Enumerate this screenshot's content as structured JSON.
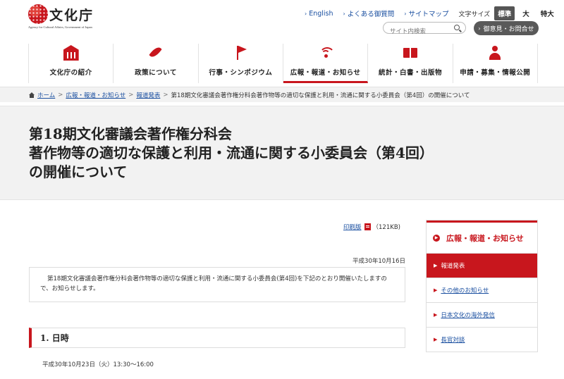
{
  "logo": {
    "text": "文化庁",
    "subtitle": "Agency for Cultural Affairs, Government of Japan"
  },
  "toplinks": [
    {
      "label": "English"
    },
    {
      "label": "よくある御質問"
    },
    {
      "label": "サイトマップ"
    }
  ],
  "font_size": {
    "label": "文字サイズ",
    "options": [
      "標準",
      "大",
      "特大"
    ],
    "selected": "標準"
  },
  "search": {
    "placeholder": "サイト内検索"
  },
  "opinion_button": {
    "label": "御意見・お問合せ"
  },
  "global_nav": [
    {
      "label": "文化庁の紹介",
      "icon": "building-icon"
    },
    {
      "label": "政策について",
      "icon": "feather-icon"
    },
    {
      "label": "行事・シンポジウム",
      "icon": "flag-icon"
    },
    {
      "label": "広報・報道・お知らせ",
      "icon": "broadcast-icon",
      "active": true
    },
    {
      "label": "統計・白書・出版物",
      "icon": "book-icon"
    },
    {
      "label": "申請・募集・情報公開",
      "icon": "person-icon"
    }
  ],
  "breadcrumb": {
    "items": [
      "ホーム",
      "広報・報道・お知らせ",
      "報道発表"
    ],
    "separator": ">",
    "current": "第18期文化審議会著作権分科会著作物等の適切な保護と利用・流通に関する小委員会（第4回）の開催について"
  },
  "page_title": {
    "line1": "第18期文化審議会著作権分科会",
    "line2": "著作物等の適切な保護と利用・流通に関する小委員会（第4回）",
    "line3": "の開催について"
  },
  "print": {
    "label": "印刷版",
    "size": "（121KB)"
  },
  "date": "平成30年10月16日",
  "lead": "第18期文化審議会著作権分科会著作物等の適切な保護と利用・流通に関する小委員会(第4回)を下記のとおり開催いたしますので、お知らせします。",
  "section1": {
    "heading": "1.  日時",
    "body": "平成30年10月23日（火）13:30～16:00"
  },
  "sidenav": {
    "heading": "広報・報道・お知らせ",
    "items": [
      {
        "label": "報道発表",
        "active": true
      },
      {
        "label": "その他のお知らせ"
      },
      {
        "label": "日本文化の海外発信"
      },
      {
        "label": "長官対談"
      }
    ]
  },
  "colors": {
    "accent": "#c8161d",
    "link": "#1a4fa0",
    "band": "#f2f2f2"
  }
}
